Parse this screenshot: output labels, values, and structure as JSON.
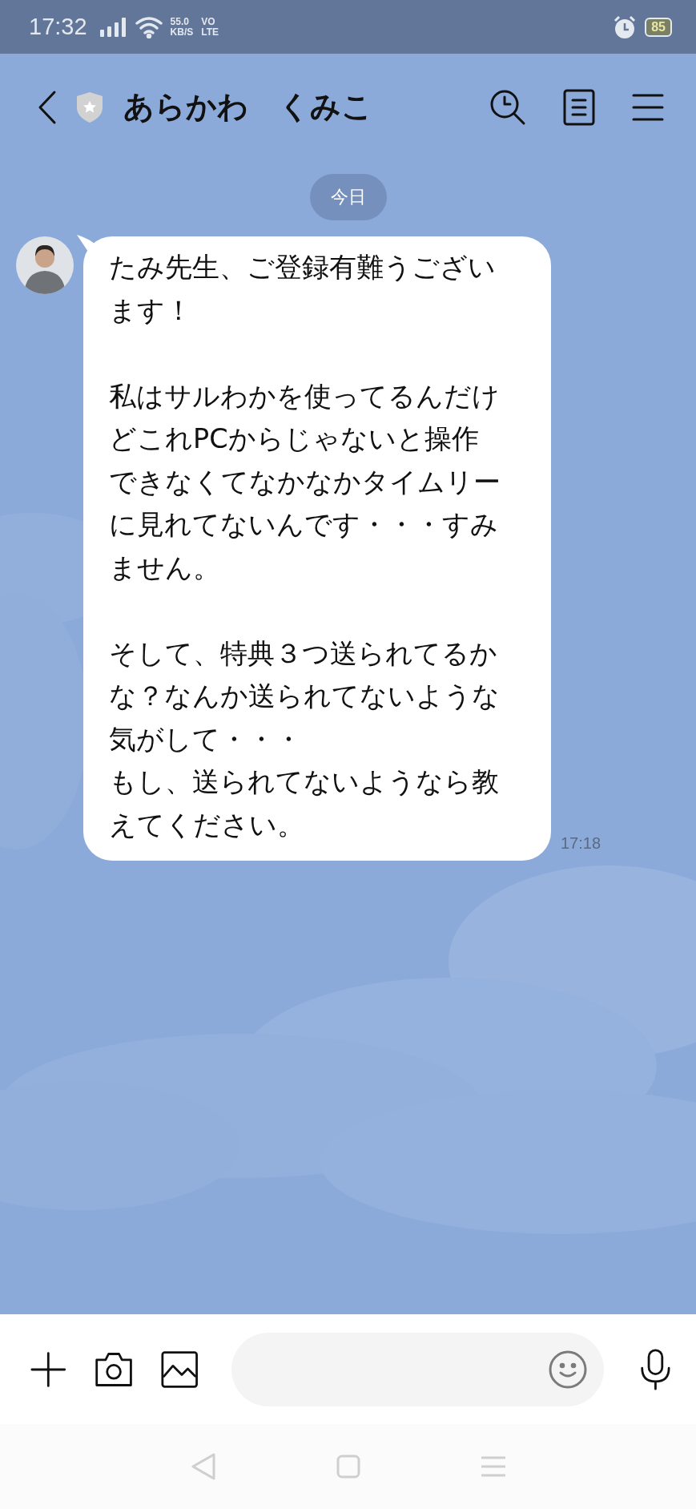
{
  "status_bar": {
    "time": "17:32",
    "speed_value": "55.0",
    "speed_unit": "KB/S",
    "volte_top": "VO",
    "volte_bottom": "LTE",
    "battery": "85"
  },
  "header": {
    "title": "あらかわ　くみこ"
  },
  "date_label": "今日",
  "messages": [
    {
      "kind": "incoming",
      "paragraphs": [
        [
          "たみ先生、ご登録有難うございます！"
        ],
        [
          "私はサルわかを使ってるんだけどこれPCからじゃないと操作できなくてなかなかタイムリーに見れてないんです・・・すみません。"
        ],
        [
          "そして、特典３つ送られてるかな？なんか送られてないような気がして・・・",
          "もし、送られてないようなら教えてください。"
        ]
      ],
      "time": "17:18"
    }
  ]
}
